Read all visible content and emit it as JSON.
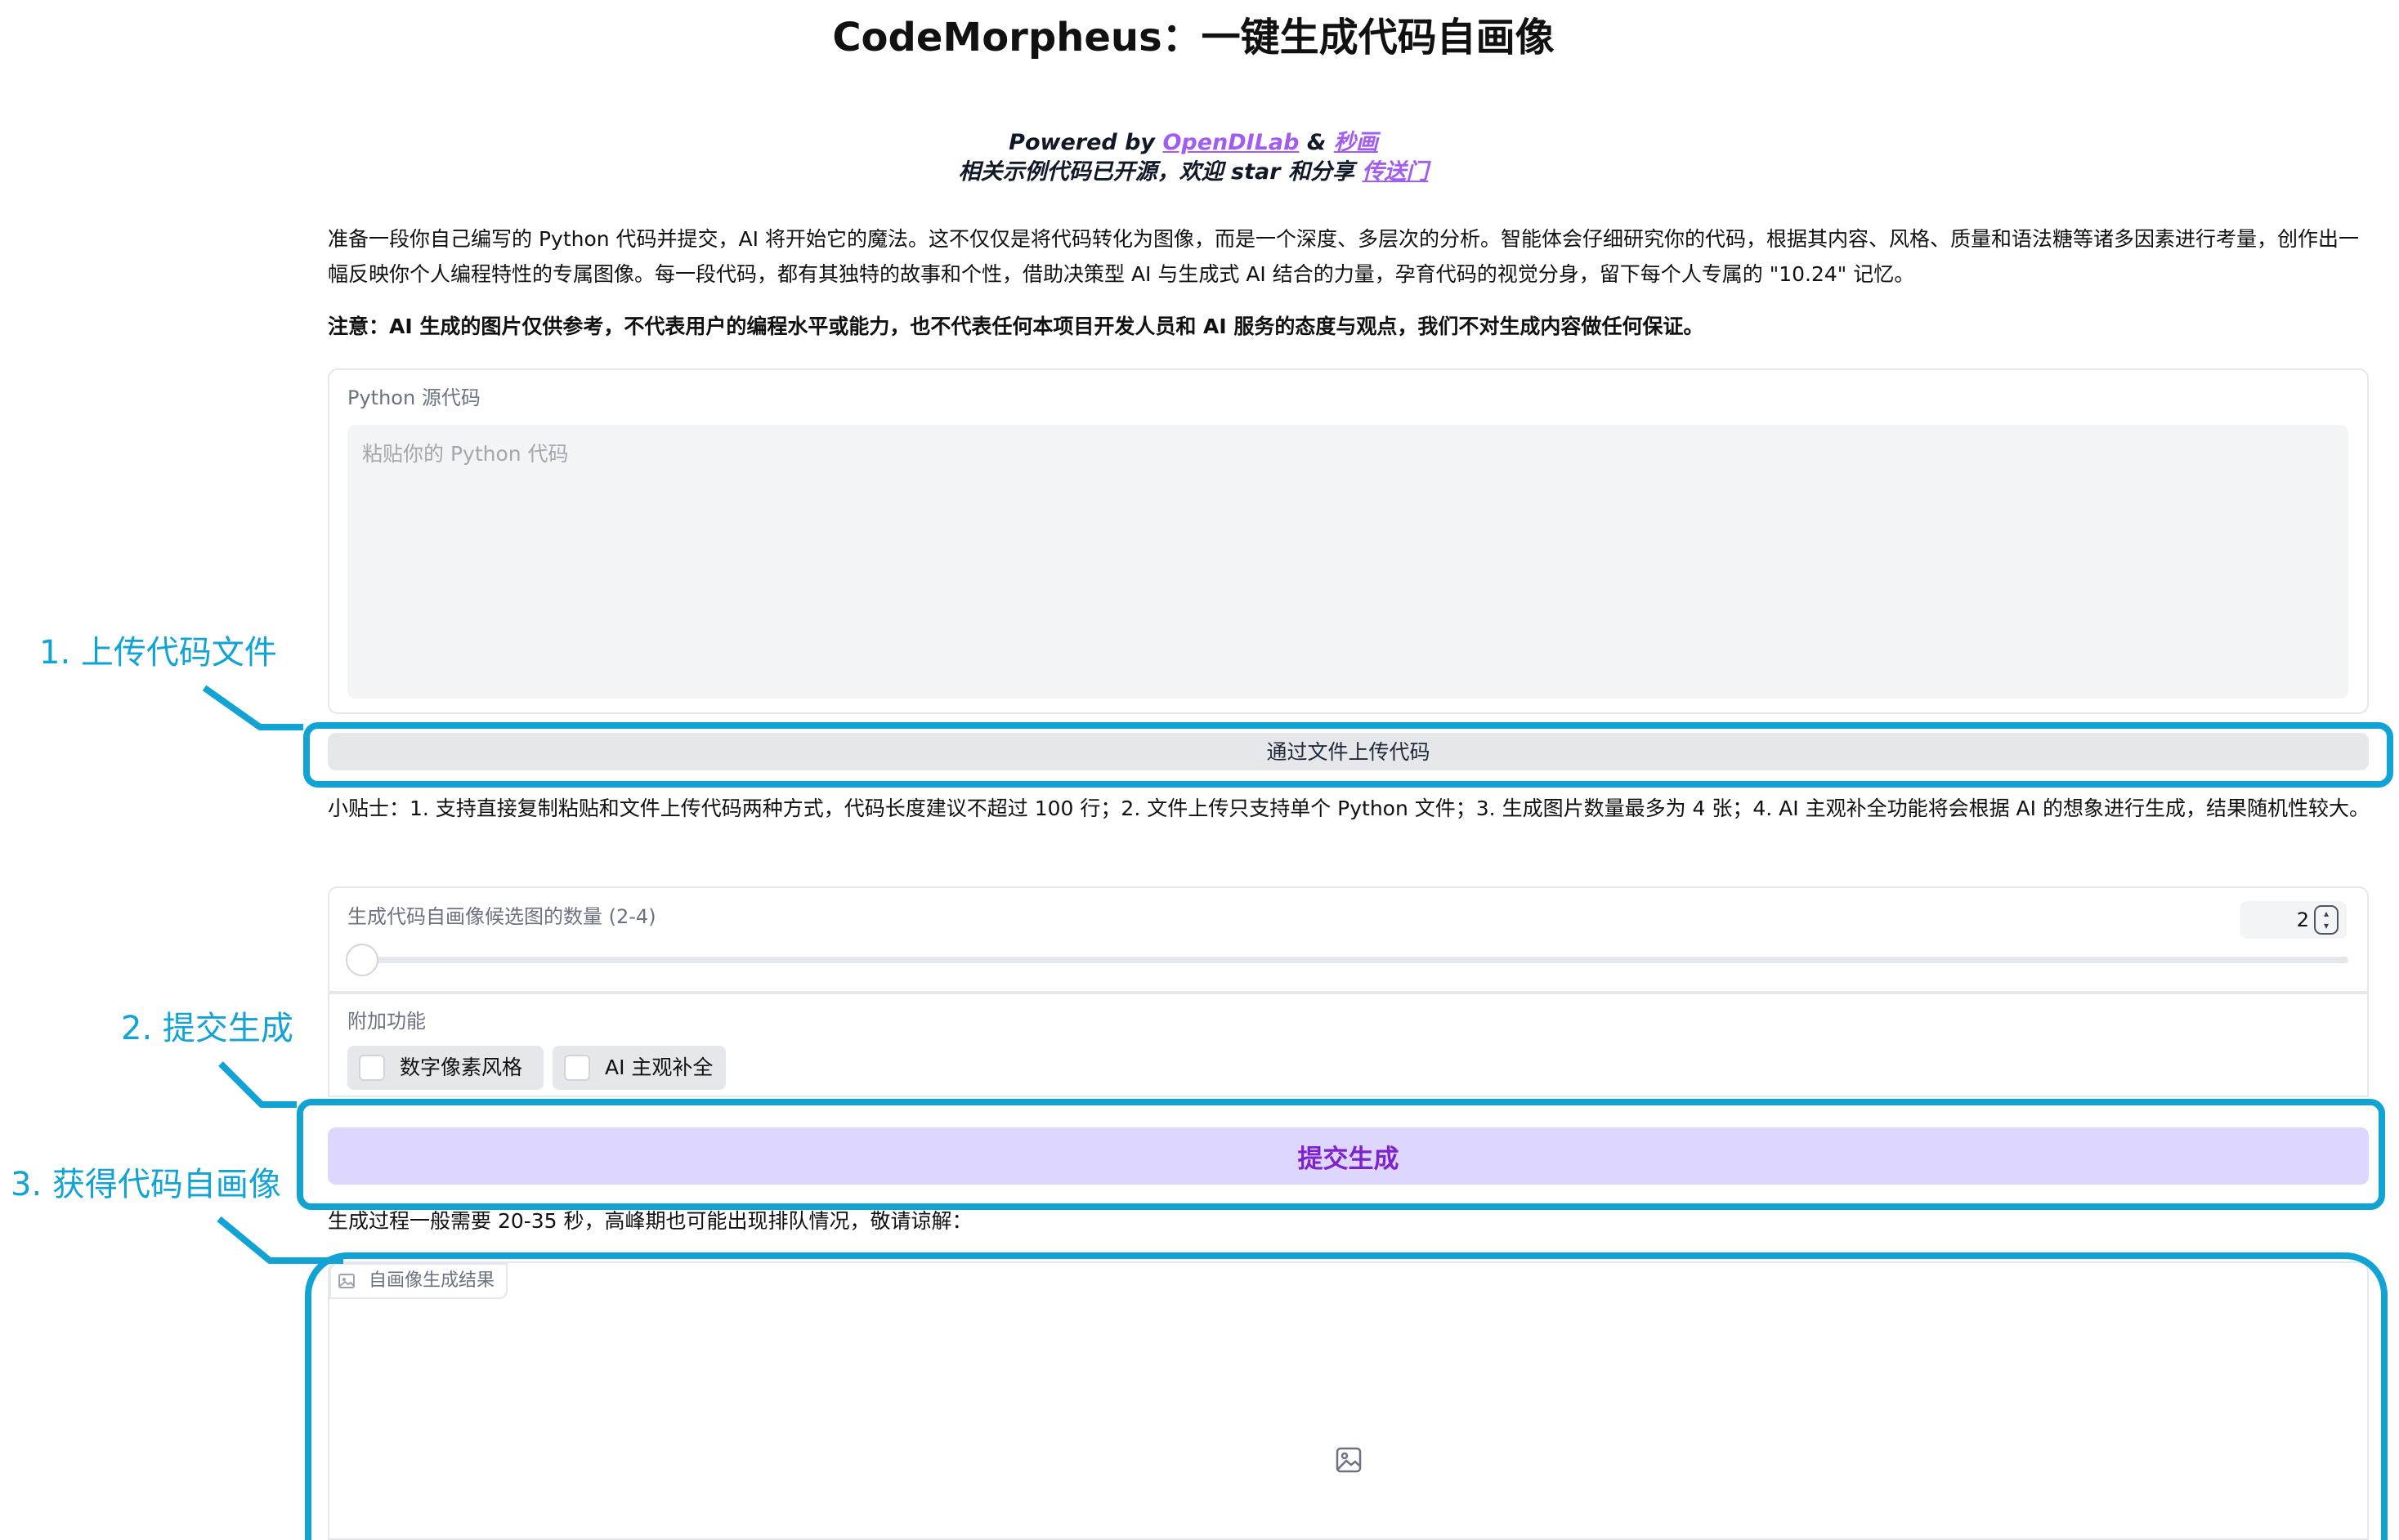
{
  "header": {
    "title": "CodeMorpheus：一键生成代码自画像",
    "powered_prefix": "Powered by",
    "powered_link1": "OpenDILab",
    "powered_amp": "&",
    "powered_link2": "秒画",
    "opensource_text": "相关示例代码已开源，欢迎 star 和分享",
    "opensource_link": "传送门"
  },
  "intro": {
    "description": "准备一段你自己编写的 Python 代码并提交，AI 将开始它的魔法。这不仅仅是将代码转化为图像，而是一个深度、多层次的分析。智能体会仔细研究你的代码，根据其内容、风格、质量和语法糖等诸多因素进行考量，创作出一幅反映你个人编程特性的专属图像。每一段代码，都有其独特的故事和个性，借助决策型 AI 与生成式 AI 结合的力量，孕育代码的视觉分身，留下每个人专属的 \"10.24\" 记忆。",
    "disclaimer": "注意：AI 生成的图片仅供参考，不代表用户的编程水平或能力，也不代表任何本项目开发人员和 AI 服务的态度与观点，我们不对生成内容做任何保证。"
  },
  "code_input": {
    "label": "Python 源代码",
    "placeholder": "粘贴你的 Python 代码",
    "value": ""
  },
  "upload": {
    "label": "通过文件上传代码"
  },
  "tips": "小贴士：1. 支持直接复制粘贴和文件上传代码两种方式，代码长度建议不超过 100 行；2. 文件上传只支持单个 Python 文件；3. 生成图片数量最多为 4 张；4. AI 主观补全功能将会根据 AI 的想象进行生成，结果随机性较大。",
  "count_slider": {
    "label": "生成代码自画像候选图的数量 (2-4)",
    "value": "2",
    "min": 2,
    "max": 4,
    "fraction": 0.0
  },
  "features": {
    "label": "附加功能",
    "options": [
      {
        "label": "数字像素风格",
        "checked": false
      },
      {
        "label": "AI 主观补全",
        "checked": false
      }
    ]
  },
  "submit": {
    "label": "提交生成"
  },
  "wait_text": "生成过程一般需要 20-35 秒，高峰期也可能出现排队情况，敬请谅解：",
  "result": {
    "label": "自画像生成结果",
    "icon": "image-icon"
  },
  "annotations": {
    "step1": "1. 上传代码文件",
    "step2": "2. 提交生成",
    "step3": "3. 获得代码自画像",
    "color": "#10a3d4"
  },
  "colors": {
    "accent": "#7e22ce",
    "submit_bg": "#ddd6fe",
    "link": "#a35cf0",
    "panel_border": "#e5e7eb"
  }
}
